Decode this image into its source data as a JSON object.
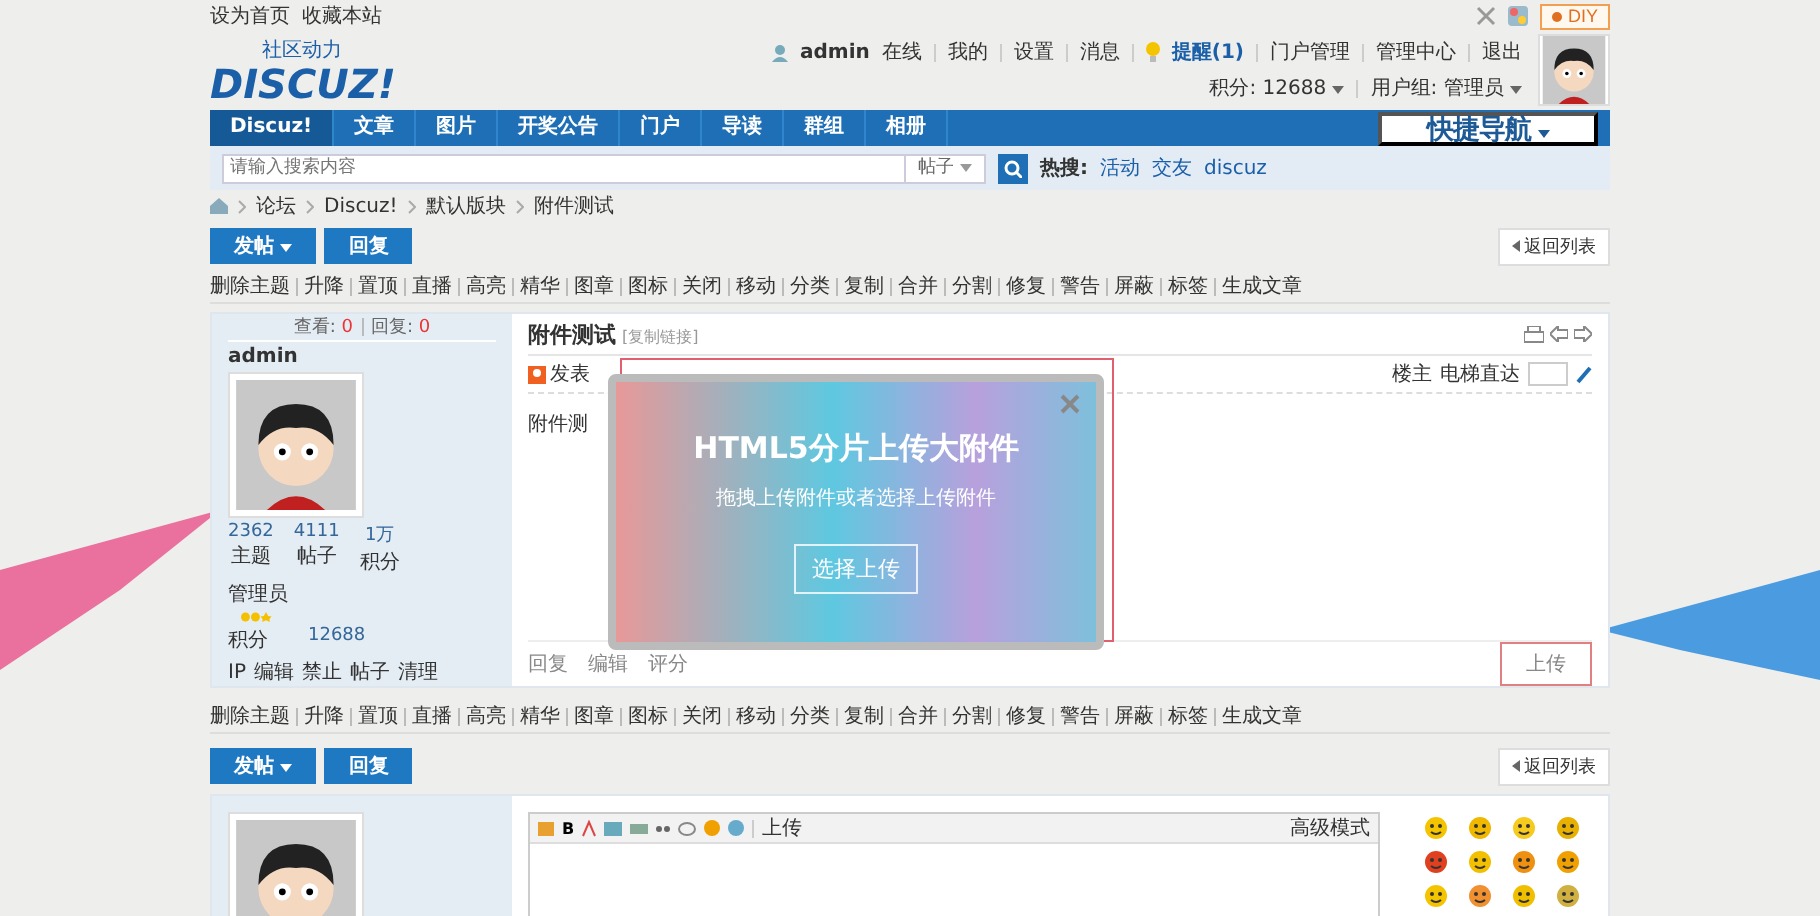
{
  "top_bar": {
    "links": [
      "设为首页",
      "收藏本站"
    ],
    "diy": "DIY"
  },
  "header": {
    "logo_tagline": "社区动力",
    "logo": "DISCUZ!",
    "user": "admin",
    "status": "在线",
    "menu": [
      "我的",
      "设置",
      "消息"
    ],
    "notice": "提醒(1)",
    "admin_links": [
      "门户管理",
      "管理中心",
      "退出"
    ],
    "points": "积分: 12688",
    "group": "用户组: 管理员"
  },
  "nav": {
    "items": [
      {
        "label": "Discuz!",
        "selected": true
      },
      {
        "label": "文章",
        "selected": false
      },
      {
        "label": "图片",
        "selected": false
      },
      {
        "label": "开奖公告",
        "selected": false
      },
      {
        "label": "门户",
        "selected": false
      },
      {
        "label": "导读",
        "selected": false
      },
      {
        "label": "群组",
        "selected": false
      },
      {
        "label": "相册",
        "selected": false
      }
    ],
    "quick_nav": "快捷导航"
  },
  "search": {
    "placeholder": "请输入搜索内容",
    "type": "帖子",
    "hot_label": "热搜:",
    "hot": [
      "活动",
      "交友",
      "discuz"
    ]
  },
  "breadcrumb": [
    "论坛",
    "Discuz!",
    "默认版块",
    "附件测试"
  ],
  "actions": {
    "post": "发帖",
    "reply": "回复",
    "back": "返回列表"
  },
  "mod_links": [
    "删除主题",
    "升降",
    "置顶",
    "直播",
    "高亮",
    "精华",
    "图章",
    "图标",
    "关闭",
    "移动",
    "分类",
    "复制",
    "合并",
    "分割",
    "修复",
    "警告",
    "屏蔽",
    "标签",
    "生成文章"
  ],
  "thread": {
    "views_label": "查看:",
    "views": "0",
    "replies_label": "回复:",
    "replies": "0",
    "title": "附件测试",
    "title_note": "[复制链接]"
  },
  "post": {
    "author": "admin",
    "stats": [
      {
        "value": "2362",
        "label": "主题"
      },
      {
        "value": "4111",
        "label": "帖子"
      },
      {
        "value": "1万",
        "label": "积分"
      }
    ],
    "group": "管理员",
    "points_label": "积分",
    "points": "12688",
    "admin_links": [
      "IP",
      "编辑",
      "禁止",
      "帖子",
      "清理"
    ],
    "posted": "发表",
    "floor": "楼主",
    "jump_label": "电梯直达",
    "content": "附件测",
    "footer": [
      "回复",
      "编辑",
      "评分"
    ],
    "upload": "上传"
  },
  "upload_dialog": {
    "title": "HTML5分片上传大附件",
    "subtitle": "拖拽上传附件或者选择上传附件",
    "button": "选择上传"
  },
  "mod_links_bottom": [
    "删除主题",
    "升降",
    "置顶",
    "直播",
    "高亮",
    "精华",
    "图章",
    "图标",
    "关闭",
    "移动",
    "分类",
    "复制",
    "合并",
    "分割",
    "修复",
    "警告",
    "屏蔽",
    "标签",
    "生成文章"
  ],
  "actions_bottom": {
    "post": "发帖",
    "reply": "回复",
    "back": "返回列表"
  },
  "reply_box": {
    "bold": "B",
    "upload": "上传",
    "advanced": "高级模式"
  }
}
